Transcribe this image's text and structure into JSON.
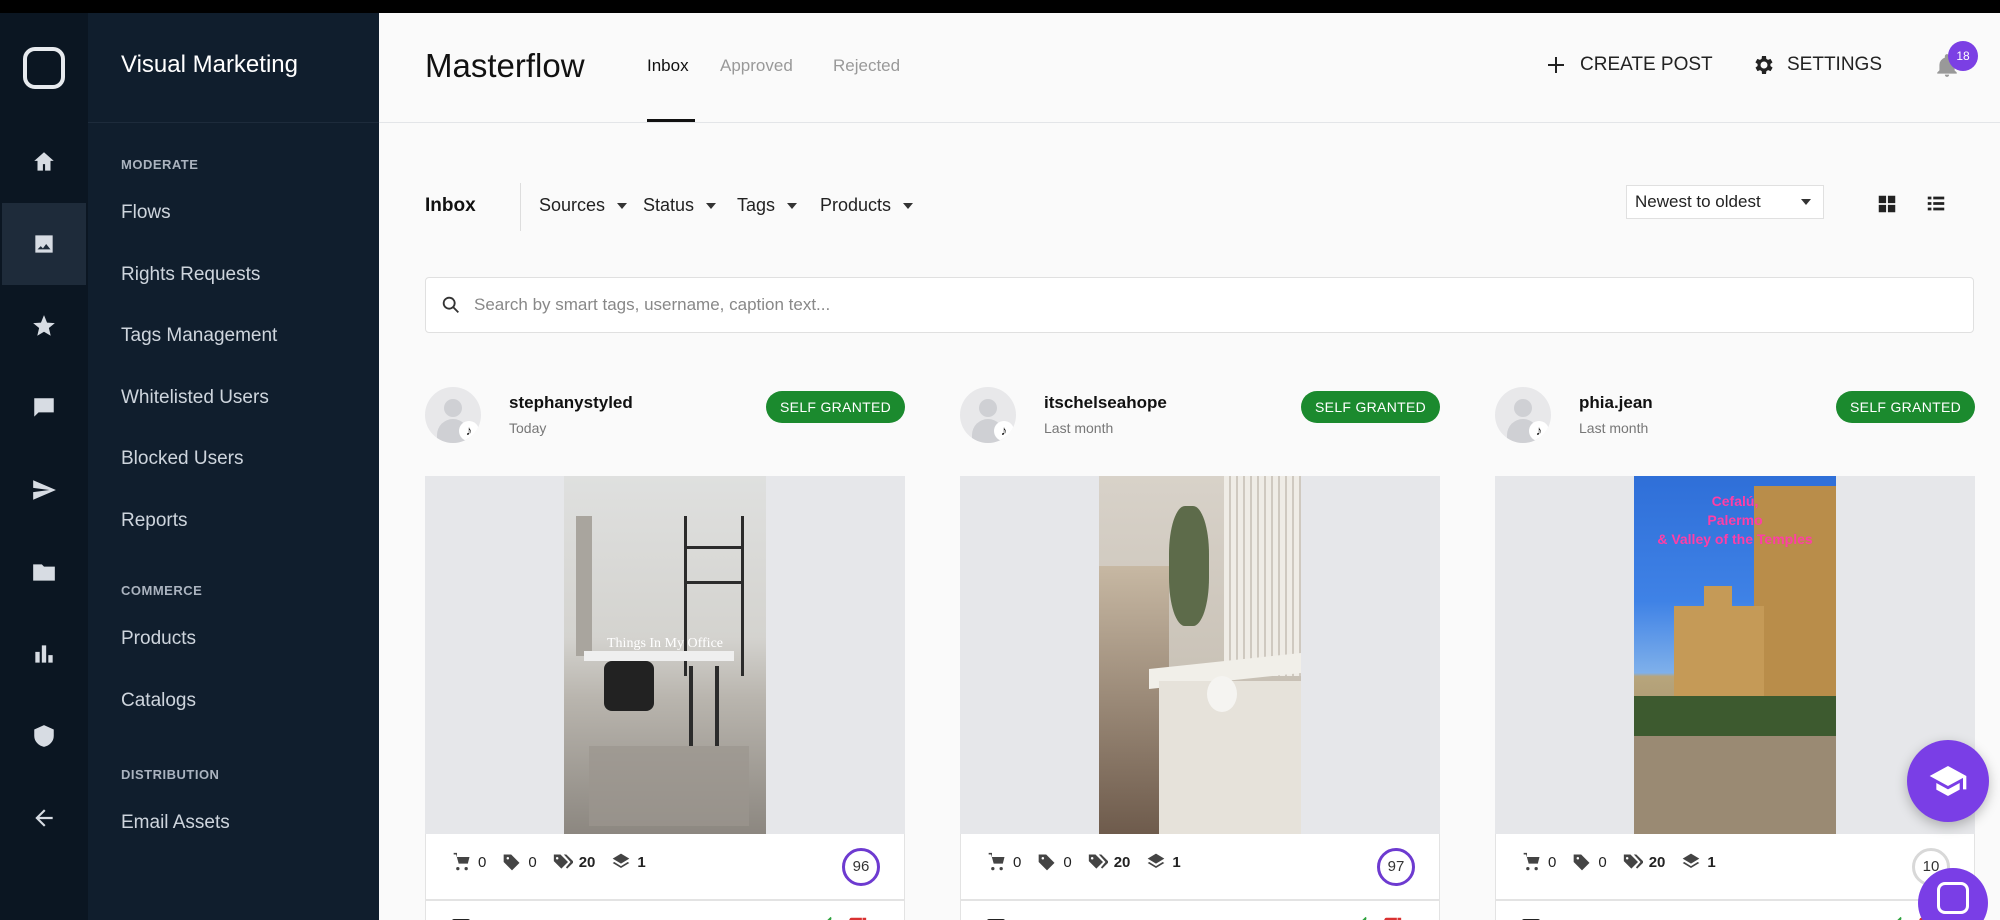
{
  "sidebar": {
    "brand": "Visual Marketing",
    "sections": [
      {
        "title": "MODERATE",
        "items": [
          "Flows",
          "Rights Requests",
          "Tags Management",
          "Whitelisted Users",
          "Blocked Users",
          "Reports"
        ]
      },
      {
        "title": "COMMERCE",
        "items": [
          "Products",
          "Catalogs"
        ]
      },
      {
        "title": "DISTRIBUTION",
        "items": [
          "Email Assets"
        ]
      }
    ],
    "rail_icons": [
      "home-icon",
      "image-icon",
      "star-icon",
      "chat-icon",
      "send-icon",
      "folder-icon",
      "bar-chart-icon",
      "shield-icon",
      "back-arrow-icon"
    ]
  },
  "header": {
    "title": "Masterflow",
    "tabs": [
      "Inbox",
      "Approved",
      "Rejected"
    ],
    "create_post": "CREATE POST",
    "settings": "SETTINGS",
    "notification_count": "18"
  },
  "filters": {
    "title": "Inbox",
    "items": [
      "Sources",
      "Status",
      "Tags",
      "Products"
    ],
    "sort": "Newest to oldest"
  },
  "search": {
    "placeholder": "Search by smart tags, username, caption text..."
  },
  "cards": [
    {
      "username": "stephanystyled",
      "time": "Today",
      "status": "SELF GRANTED",
      "overlay": "Things In My Office",
      "products": "0",
      "tags": "0",
      "smart_tags": "20",
      "layers": "1",
      "score": "96"
    },
    {
      "username": "itschelseahope",
      "time": "Last month",
      "status": "SELF GRANTED",
      "overlay": "",
      "products": "0",
      "tags": "0",
      "smart_tags": "20",
      "layers": "1",
      "score": "97"
    },
    {
      "username": "phia.jean",
      "time": "Last month",
      "status": "SELF GRANTED",
      "overlay": "Cefalú,\nPalermo\n& Valley of the Temples",
      "products": "0",
      "tags": "0",
      "smart_tags": "20",
      "layers": "1",
      "score": "10"
    }
  ],
  "colors": {
    "rail_bg": "#0b1622",
    "nav_bg": "#101e2d",
    "accent": "#7a3ee6",
    "status_green": "#1b8a2e"
  }
}
